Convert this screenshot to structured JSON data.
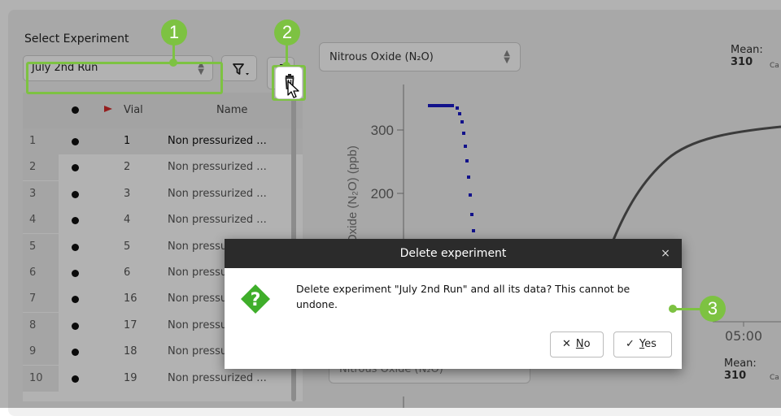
{
  "left_panel": {
    "select_label": "Select Experiment",
    "experiment_value": "July 2nd Run"
  },
  "table": {
    "headers": {
      "vial": "Vial",
      "name": "Name"
    },
    "rows": [
      {
        "num": "1",
        "vial": "1",
        "name": "Non pressurized ..."
      },
      {
        "num": "2",
        "vial": "2",
        "name": "Non pressurized ..."
      },
      {
        "num": "3",
        "vial": "3",
        "name": "Non pressurized ..."
      },
      {
        "num": "4",
        "vial": "4",
        "name": "Non pressurized ..."
      },
      {
        "num": "5",
        "vial": "5",
        "name": "Non pressurized ..."
      },
      {
        "num": "6",
        "vial": "6",
        "name": "Non pressurized ..."
      },
      {
        "num": "7",
        "vial": "16",
        "name": "Non pressurized ..."
      },
      {
        "num": "8",
        "vial": "17",
        "name": "Non pressurized ..."
      },
      {
        "num": "9",
        "vial": "18",
        "name": "Non pressurized ..."
      },
      {
        "num": "10",
        "vial": "19",
        "name": "Non pressurized ..."
      }
    ]
  },
  "plot": {
    "gas_select": "Nitrous Oxide (N₂O)",
    "mean_top_label": "Mean: ",
    "mean_top_value": "310",
    "cal_top": "Ca",
    "y_axis_label": "Oxide (N₂O) (ppb)",
    "y_ticks": [
      "300",
      "200"
    ],
    "x_tick": "05:00",
    "mean_bottom_label": "Mean: ",
    "mean_bottom_value": "310",
    "cal_bottom": "Ca",
    "gas_select_2": "Nitrous Oxide (N₂O)"
  },
  "annotations": {
    "badge_1": "1",
    "badge_2": "2",
    "badge_3": "3"
  },
  "dialog": {
    "title": "Delete experiment",
    "close": "×",
    "message": "Delete experiment \"July 2nd Run\" and all its data? This cannot be undone.",
    "no_prefix": "",
    "no_accel": "N",
    "no_rest": "o",
    "yes_accel": "Y",
    "yes_rest": "es"
  },
  "colors": {
    "accent": "#7dc242",
    "dialog_title_bg": "#2b2b2b",
    "series_blue": "#1a1ac8",
    "series_gray": "#555555",
    "question_icon": "#3fae2a"
  },
  "icons": {
    "filter": "filter-icon",
    "trash": "trash-icon",
    "question": "question-icon",
    "close": "close-icon",
    "no": "x-icon",
    "yes": "check-icon",
    "flag": "flag-icon"
  }
}
